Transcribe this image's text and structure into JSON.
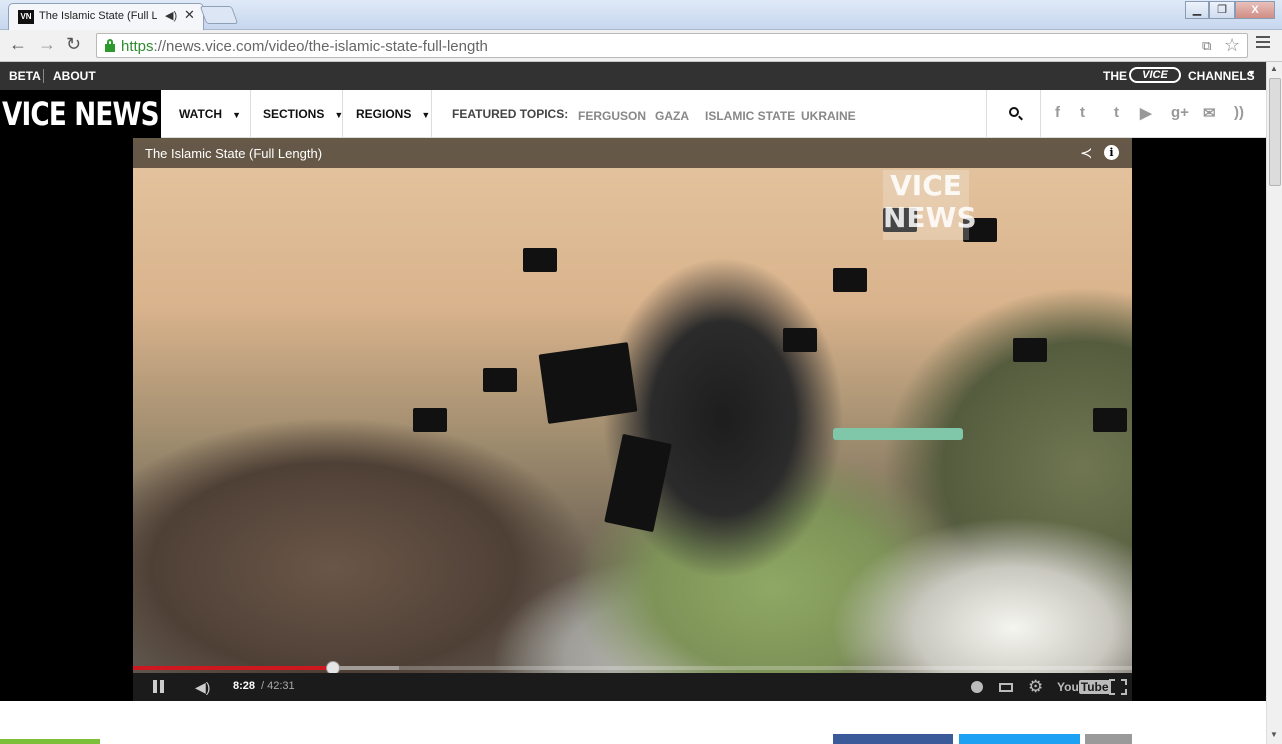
{
  "browser": {
    "tab": {
      "favicon_text": "VN",
      "title": "The Islamic State (Full Length)",
      "audio_icon": "speaker-icon",
      "close_glyph": "✕"
    },
    "window_controls": {
      "minimize": "▁",
      "maximize": "❐",
      "close": "X"
    },
    "nav": {
      "back": "←",
      "forward": "→",
      "reload": "↻"
    },
    "url": {
      "scheme": "https",
      "rest": "://news.vice.com/video/the-islamic-state-full-length"
    },
    "star_glyph": "☆",
    "translate_glyph": "⧉"
  },
  "site": {
    "topbar": {
      "beta": "BETA",
      "about": "ABOUT",
      "the": "THE",
      "vice": "VICE",
      "channels": "CHANNELS",
      "caret": "▼"
    },
    "logo": "VICE NEWS",
    "nav": {
      "watch": "WATCH",
      "sections": "SECTIONS",
      "regions": "REGIONS",
      "caret": "▼",
      "featured_label": "FEATURED TOPICS:",
      "topics": [
        "FERGUSON",
        "GAZA",
        "ISLAMIC STATE",
        "UKRAINE"
      ]
    },
    "social": [
      "f",
      "t",
      "t",
      "▶",
      "g+",
      "✉",
      "))"
    ],
    "social_icons": [
      "facebook-icon",
      "twitter-icon",
      "tumblr-icon",
      "youtube-icon",
      "google-plus-icon",
      "email-icon",
      "rss-icon"
    ]
  },
  "video": {
    "title": "The Islamic State (Full Length)",
    "share_glyph": "≺",
    "info_glyph": "i",
    "watermark_line1": "VICE",
    "watermark_line2": "NEWS",
    "progress_fraction": 0.2,
    "time_current": "8:28",
    "time_total": " / 42:31",
    "volume_glyph": "🔈",
    "settings_glyph": "⚙",
    "youtube_you": "You",
    "youtube_tube": "Tube",
    "accent": "#cc181e"
  }
}
